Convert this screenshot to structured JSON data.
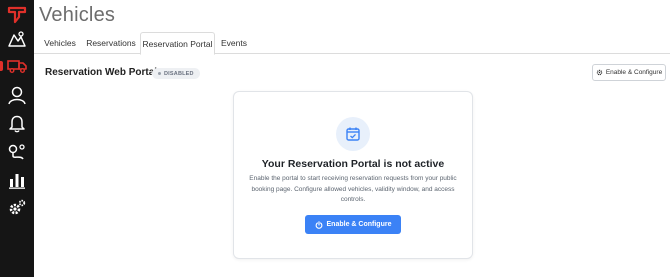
{
  "page": {
    "title": "Vehicles"
  },
  "sidebar": {
    "items": [
      {
        "name": "logo",
        "icon": "logo-icon"
      },
      {
        "name": "map",
        "icon": "map-icon"
      },
      {
        "name": "vehicles",
        "icon": "truck-icon",
        "active": true
      },
      {
        "name": "users",
        "icon": "user-icon"
      },
      {
        "name": "notifications",
        "icon": "bell-icon"
      },
      {
        "name": "routes",
        "icon": "route-icon"
      },
      {
        "name": "reports",
        "icon": "chart-icon"
      },
      {
        "name": "settings",
        "icon": "gear-icon"
      }
    ],
    "accent": "#e0302a"
  },
  "tabs": [
    {
      "label": "Vehicles",
      "active": false
    },
    {
      "label": "Reservations",
      "active": false
    },
    {
      "label": "Reservation Portal",
      "active": true
    },
    {
      "label": "Events",
      "active": false
    }
  ],
  "section": {
    "title": "Reservation Web Portal",
    "status_badge": "DISABLED",
    "enable_button": "Enable & Configure"
  },
  "card": {
    "icon": "calendar-check-icon",
    "title": "Your Reservation Portal is not active",
    "description": "Enable the portal to start receiving reservation requests from your public booking page. Configure allowed vehicles, validity window, and access controls.",
    "button_label": "Enable & Configure",
    "button_color": "#3b82f6"
  }
}
